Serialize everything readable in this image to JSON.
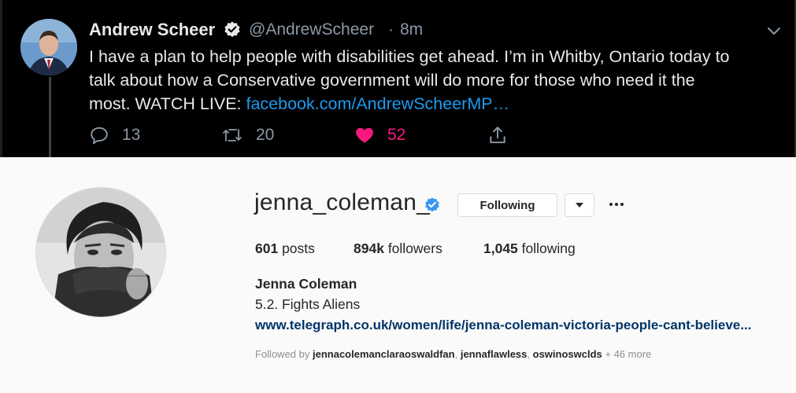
{
  "tweet": {
    "author_name": "Andrew Scheer",
    "handle": "@AndrewScheer",
    "separator": "·",
    "time": "8m",
    "text_line1": "I have a plan to help people with disabilities get ahead. I’m in Whitby, Ontario today to",
    "text_line2": "talk about how a Conservative government will do more for those who need it the",
    "text_line3": "most. WATCH LIVE: ",
    "link_text": "facebook.com/AndrewScheerMP…",
    "replies": "13",
    "retweets": "20",
    "likes": "52",
    "colors": {
      "background": "#000000",
      "text": "#e7e9ea",
      "muted": "#8b98a5",
      "link": "#1d9bf0",
      "like": "#f91880"
    }
  },
  "profile": {
    "username": "jenna_coleman_",
    "follow_button_label": "Following",
    "posts_count": "601",
    "posts_label": "posts",
    "followers_count": "894k",
    "followers_label": "followers",
    "following_count": "1,045",
    "following_label": "following",
    "full_name": "Jenna Coleman",
    "bio": "5.2. Fights Aliens",
    "website": "www.telegraph.co.uk/women/life/jenna-coleman-victoria-people-cant-believe...",
    "followed_by_prefix": "Followed by ",
    "followed_by_users": [
      "jennacolemanclaraoswaldfan",
      "jennaflawless",
      "oswinoswclds"
    ],
    "followed_by_separator": ", ",
    "followed_by_more": " + 46 more",
    "colors": {
      "link": "#003569",
      "verified": "#3897f0",
      "muted": "#8e8e8e"
    }
  },
  "icons": [
    "verified-badge-icon",
    "chevron-down-icon",
    "reply-icon",
    "retweet-icon",
    "heart-icon",
    "share-icon",
    "caret-down-icon",
    "more-options-icon"
  ]
}
